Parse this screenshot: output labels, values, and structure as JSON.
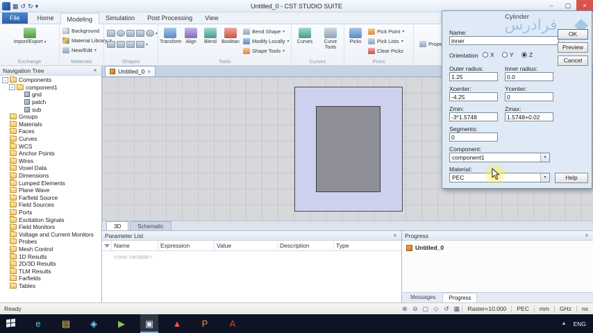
{
  "colors": {
    "accent_blue": "#2f6bbf",
    "substrate": "#cdd1ed",
    "patch": "#8e8f97",
    "taskbar_bg": "#0e1424",
    "dialog_bg": "#dfeaf6",
    "close_button": "#d9544c"
  },
  "glyphs": {
    "dropdown": "▾",
    "close": "×",
    "minimize": "–",
    "maximize": "▢",
    "collapse": "-",
    "save": "▦",
    "undo": "↺",
    "redo": "↻",
    "overflow": "▲"
  },
  "window": {
    "title": "Untitled_0 - CST STUDIO SUITE"
  },
  "ribbon": {
    "tabs": [
      "File",
      "Home",
      "Modeling",
      "Simulation",
      "Post Processing",
      "View"
    ],
    "selected_tab": "Modeling",
    "groups": {
      "exchange": {
        "label": "Exchange",
        "import_export": "Import/Export"
      },
      "materials": {
        "label": "Materials",
        "background": "Background",
        "material_library": "Material Library",
        "new_edit": "New/Edit"
      },
      "shapes": {
        "label": "Shapes"
      },
      "tools": {
        "label": "Tools",
        "transform": "Transform",
        "align": "Align",
        "blend": "Blend",
        "boolean": "Boolean",
        "bend_shape": "Bend Shape",
        "modify_locally": "Modify Locally",
        "shape_tools": "Shape Tools"
      },
      "curves": {
        "label": "Curves",
        "curves": "Curves",
        "curve_tools": "Curve Tools"
      },
      "picks": {
        "label": "Picks",
        "picks": "Picks",
        "pick_point": "Pick Point",
        "pick_lists": "Pick Lists",
        "clear_picks": "Clear Picks"
      },
      "edit": {
        "properties": "Properties..."
      }
    }
  },
  "nav_tree": {
    "title": "Navigation Tree",
    "items": [
      {
        "label": "Components",
        "depth": 0,
        "icon": "folder",
        "expanded": true
      },
      {
        "label": "component1",
        "depth": 1,
        "icon": "folder",
        "expanded": true
      },
      {
        "label": "gnd",
        "depth": 2,
        "icon": "cube"
      },
      {
        "label": "patch",
        "depth": 2,
        "icon": "cube"
      },
      {
        "label": "sub",
        "depth": 2,
        "icon": "cube"
      },
      {
        "label": "Groups",
        "depth": 0,
        "icon": "folder"
      },
      {
        "label": "Materials",
        "depth": 0,
        "icon": "folder"
      },
      {
        "label": "Faces",
        "depth": 0,
        "icon": "folder"
      },
      {
        "label": "Curves",
        "depth": 0,
        "icon": "folder"
      },
      {
        "label": "WCS",
        "depth": 0,
        "icon": "folder"
      },
      {
        "label": "Anchor Points",
        "depth": 0,
        "icon": "folder"
      },
      {
        "label": "Wires",
        "depth": 0,
        "icon": "folder"
      },
      {
        "label": "Voxel Data",
        "depth": 0,
        "icon": "folder"
      },
      {
        "label": "Dimensions",
        "depth": 0,
        "icon": "folder"
      },
      {
        "label": "Lumped Elements",
        "depth": 0,
        "icon": "folder"
      },
      {
        "label": "Plane Wave",
        "depth": 0,
        "icon": "folder"
      },
      {
        "label": "Farfield Source",
        "depth": 0,
        "icon": "folder"
      },
      {
        "label": "Field Sources",
        "depth": 0,
        "icon": "folder"
      },
      {
        "label": "Ports",
        "depth": 0,
        "icon": "folder"
      },
      {
        "label": "Excitation Signals",
        "depth": 0,
        "icon": "folder"
      },
      {
        "label": "Field Monitors",
        "depth": 0,
        "icon": "folder"
      },
      {
        "label": "Voltage and Current Monitors",
        "depth": 0,
        "icon": "folder"
      },
      {
        "label": "Probes",
        "depth": 0,
        "icon": "folder"
      },
      {
        "label": "Mesh Control",
        "depth": 0,
        "icon": "folder"
      },
      {
        "label": "1D Results",
        "depth": 0,
        "icon": "folder"
      },
      {
        "label": "2D/3D Results",
        "depth": 0,
        "icon": "folder"
      },
      {
        "label": "TLM Results",
        "depth": 0,
        "icon": "folder"
      },
      {
        "label": "Farfields",
        "depth": 0,
        "icon": "folder"
      },
      {
        "label": "Tables",
        "depth": 0,
        "icon": "folder"
      }
    ]
  },
  "document": {
    "tab": "Untitled_0",
    "view_tabs": [
      "3D",
      "Schematic"
    ],
    "selected_view": "3D"
  },
  "parameter_list": {
    "title": "Parameter List",
    "columns": [
      "Name",
      "Expression",
      "Value",
      "Description",
      "Type"
    ],
    "placeholder": "<new variable>"
  },
  "progress_panel": {
    "title": "Progress",
    "item": "Untitled_0",
    "tabs": [
      "Messages",
      "Progress"
    ],
    "selected_tab": "Progress"
  },
  "dialog": {
    "title": "Cylinder",
    "watermark": "فرادرس",
    "name_label": "Name:",
    "name_value": "inner",
    "orientation_label": "Orientation",
    "orientation": {
      "x": "X",
      "y": "Y",
      "z": "Z",
      "selected": "Z"
    },
    "outer_radius_label": "Outer radius:",
    "outer_radius": "1.25",
    "inner_radius_label": "Inner radius:",
    "inner_radius": "0.0",
    "xcenter_label": "Xcenter:",
    "xcenter": "-4.25",
    "ycenter_label": "Ycenter:",
    "ycenter": "0",
    "zmin_label": "Zmin:",
    "zmin": "-3*1.5748",
    "zmax_label": "Zmax:",
    "zmax": "1.5748+0.02",
    "segments_label": "Segments:",
    "segments": "0",
    "component_label": "Component:",
    "component": "component1",
    "material_label": "Material:",
    "material": "PEC",
    "ok": "OK",
    "preview": "Preview",
    "cancel": "Cancel",
    "help": "Help"
  },
  "status_bar": {
    "ready": "Ready",
    "raster": "Raster=10.000",
    "items": [
      "PEC",
      "mm",
      "GHz",
      "ns"
    ],
    "icons": [
      {
        "name": "zoom-in-icon",
        "glyph": "⊕"
      },
      {
        "name": "zoom-out-icon",
        "glyph": "⊖"
      },
      {
        "name": "zoom-fit-icon",
        "glyph": "▢"
      },
      {
        "name": "select-icon",
        "glyph": "◇"
      },
      {
        "name": "rotate-view-icon",
        "glyph": "↺"
      },
      {
        "name": "grid-icon",
        "glyph": "▦"
      }
    ]
  },
  "taskbar": {
    "language": "ENG",
    "items": [
      {
        "name": "internet-explorer",
        "glyph": "e",
        "color": "#5fc3f2"
      },
      {
        "name": "file-explorer",
        "glyph": "▤",
        "color": "#f7d154"
      },
      {
        "name": "safari",
        "glyph": "◈",
        "color": "#6fd0f6"
      },
      {
        "name": "media-app",
        "glyph": "▶",
        "color": "#8bc34a"
      },
      {
        "name": "cst-studio",
        "glyph": "▣",
        "color": "#dce9f5",
        "active": true
      },
      {
        "name": "adobe-app",
        "glyph": "▲",
        "color": "#f0564a"
      },
      {
        "name": "powerpoint",
        "glyph": "P",
        "color": "#f08a4b"
      },
      {
        "name": "acrobat-reader",
        "glyph": "A",
        "color": "#e23f36"
      }
    ]
  }
}
